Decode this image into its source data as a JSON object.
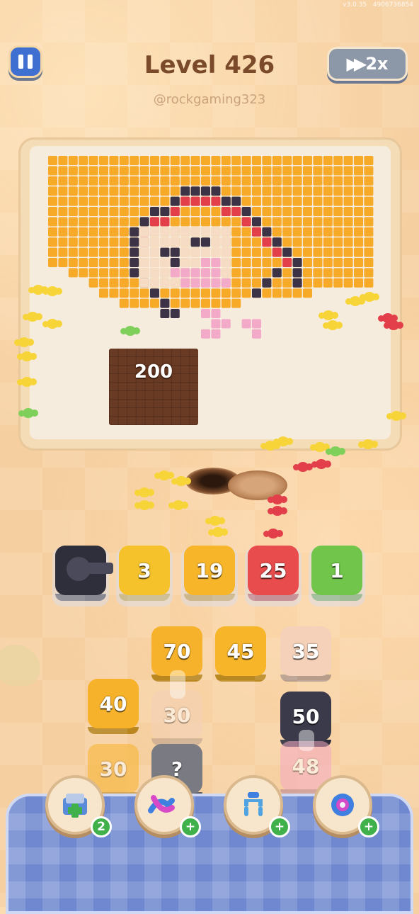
{
  "status_bar": {
    "left": "v3.0.35",
    "right": "4906736854"
  },
  "header": {
    "level_title": "Level 426",
    "username": "@rockgaming323",
    "speed_label": "2x"
  },
  "board": {
    "chocolate_count": "200"
  },
  "conveyor_slots": [
    {
      "label": "",
      "color": "#2f2f3c"
    },
    {
      "label": "3",
      "color": "#f5c22c"
    },
    {
      "label": "19",
      "color": "#f7b52a"
    },
    {
      "label": "25",
      "color": "#e84c4c"
    },
    {
      "label": "1",
      "color": "#70c54a"
    }
  ],
  "stack_tiles": [
    {
      "label": "70",
      "color": "#f7b22b"
    },
    {
      "label": "45",
      "color": "#f7b52a"
    },
    {
      "label": "35",
      "color": "#f4d1b8"
    },
    {
      "label": "40",
      "color": "#f7b22b"
    },
    {
      "label": "30",
      "color": "#f4d1b8"
    },
    {
      "label": "50",
      "color": "#3a3a4a"
    },
    {
      "label": "30",
      "color": "#f7b22b"
    },
    {
      "label": "?",
      "color": "#7a7a82"
    },
    {
      "label": "48",
      "color": "#f5a9c4"
    }
  ],
  "powerups": [
    {
      "name": "add-slot",
      "badge": "2"
    },
    {
      "name": "shuffle",
      "badge": "+"
    },
    {
      "name": "magnet",
      "badge": "+"
    },
    {
      "name": "bomb",
      "badge": "+"
    }
  ],
  "colors": {
    "orange": "#f7a928",
    "dark": "#3d3346",
    "red": "#e23f4a",
    "skin": "#f6dcc4",
    "pink": "#f3a9c8",
    "yellow_ant": "#f7d437"
  }
}
